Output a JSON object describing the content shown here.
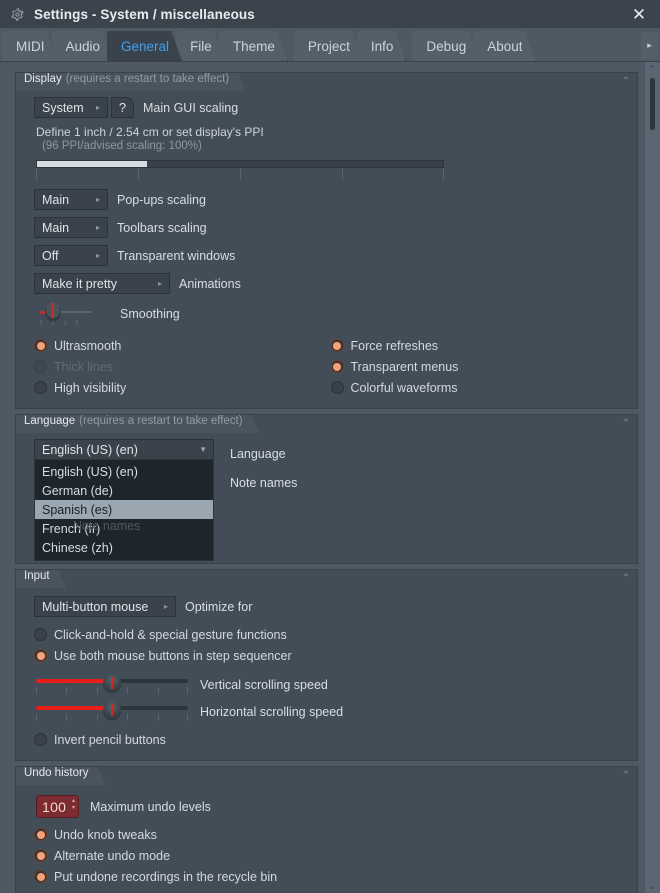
{
  "window": {
    "title": "Settings - System / miscellaneous",
    "gear_icon": "gear-icon",
    "close_icon": "close-icon",
    "close_label": "✕"
  },
  "tabs": {
    "items": [
      {
        "label": "MIDI",
        "active": false
      },
      {
        "label": "Audio",
        "active": false
      },
      {
        "label": "General",
        "active": true
      },
      {
        "label": "File",
        "active": false
      },
      {
        "label": "Theme",
        "active": false
      },
      {
        "label": "Project",
        "active": false
      },
      {
        "label": "Info",
        "active": false
      },
      {
        "label": "Debug",
        "active": false
      },
      {
        "label": "About",
        "active": false
      }
    ],
    "more_label": "▸"
  },
  "display": {
    "title": "Display",
    "subtitle": "(requires a restart to take effect)",
    "collapse_label": "⌃",
    "gui_scaling": {
      "value": "System",
      "label": "Main GUI scaling",
      "arrow": "▸",
      "help_label": "?"
    },
    "ppi_hint": "Define 1 inch / 2.54 cm or set display's PPI",
    "ppi_hint2": "(96 PPI/advised scaling: 100%)",
    "ppi_fill_percent": 27,
    "popups_scaling": {
      "value": "Main",
      "label": "Pop-ups scaling",
      "arrow": "▸"
    },
    "toolbars_scaling": {
      "value": "Main",
      "label": "Toolbars scaling",
      "arrow": "▸"
    },
    "transparent_windows": {
      "value": "Off",
      "label": "Transparent windows",
      "arrow": "▸"
    },
    "animations": {
      "value": "Make it pretty",
      "label": "Animations",
      "arrow": "▸"
    },
    "smoothing_label": "Smoothing",
    "options_left": [
      {
        "label": "Ultrasmooth",
        "on": true,
        "disabled": false
      },
      {
        "label": "Thick lines",
        "on": false,
        "disabled": true
      },
      {
        "label": "High visibility",
        "on": false,
        "disabled": false
      }
    ],
    "options_right": [
      {
        "label": "Force refreshes",
        "on": true,
        "disabled": false
      },
      {
        "label": "Transparent menus",
        "on": true,
        "disabled": false
      },
      {
        "label": "Colorful waveforms",
        "on": false,
        "disabled": false
      }
    ]
  },
  "language": {
    "title": "Language",
    "subtitle": "(requires a restart to take effect)",
    "collapse_label": "⌃",
    "selected": "English (US) (en)",
    "arrow": "▼",
    "options": [
      {
        "label": "English (US) (en)",
        "selected": false
      },
      {
        "label": "German (de)",
        "selected": false
      },
      {
        "label": "Spanish (es)",
        "selected": true
      },
      {
        "label": "French (fr)",
        "selected": false
      },
      {
        "label": "Chinese (zh)",
        "selected": false
      }
    ],
    "field_label": "Language",
    "note_names_label": "Note names",
    "ghost_label": "Note names"
  },
  "input": {
    "title": "Input",
    "collapse_label": "⌃",
    "optimize": {
      "value": "Multi-button mouse",
      "label": "Optimize for",
      "arrow": "▸"
    },
    "options": [
      {
        "label": "Click-and-hold & special gesture functions",
        "on": false
      },
      {
        "label": "Use both mouse buttons in step sequencer",
        "on": true
      }
    ],
    "vertical_scroll": {
      "label": "Vertical scrolling speed",
      "percent": 50
    },
    "horizontal_scroll": {
      "label": "Horizontal scrolling speed",
      "percent": 50
    },
    "invert_pencil": {
      "label": "Invert pencil buttons",
      "on": false
    }
  },
  "undo": {
    "title": "Undo history",
    "collapse_label": "⌃",
    "max_levels": {
      "value": "100",
      "label": "Maximum undo levels",
      "up": "▴",
      "down": "▾"
    },
    "options": [
      {
        "label": "Undo knob tweaks",
        "on": true
      },
      {
        "label": "Alternate undo mode",
        "on": true
      },
      {
        "label": "Put undone recordings in the recycle bin",
        "on": true
      }
    ]
  },
  "scrollbar": {
    "up": "⌃",
    "down": "⌄"
  }
}
